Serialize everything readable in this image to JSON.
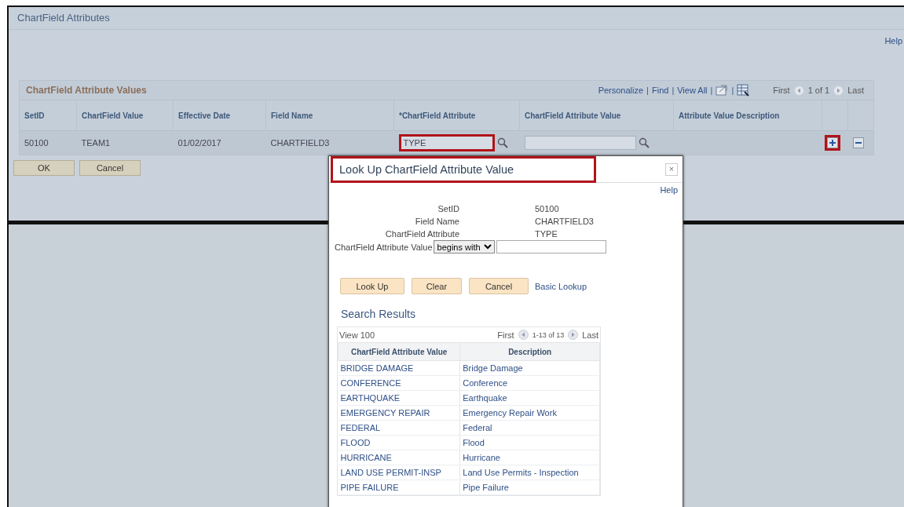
{
  "page": {
    "title": "ChartField Attributes",
    "help": "Help"
  },
  "grid": {
    "title": "ChartField Attribute Values",
    "toolbar": {
      "links": [
        "Personalize",
        "Find",
        "View All"
      ],
      "separator": "|",
      "first": "First",
      "range": "1 of 1",
      "last": "Last"
    },
    "columns": [
      "SetID",
      "ChartField Value",
      "Effective Date",
      "Field Name",
      "*ChartField Attribute",
      "ChartField Attribute Value",
      "Attribute Value Description"
    ],
    "rows": [
      {
        "setid": "50100",
        "chartfield_value": "TEAM1",
        "effective_date": "01/02/2017",
        "field_name": "CHARTFIELD3",
        "attribute": "TYPE",
        "attribute_highlighted": true,
        "add_highlighted": true
      }
    ]
  },
  "buttons": [
    "OK",
    "Cancel"
  ],
  "lookup": {
    "title": "Look Up ChartField Attribute Value",
    "title_highlighted": true,
    "close": "×",
    "help": "Help",
    "criteria": [
      {
        "label": "SetID",
        "value": "50100"
      },
      {
        "label": "Field Name",
        "value": "CHARTFIELD3"
      },
      {
        "label": "ChartField Attribute",
        "value": "TYPE"
      }
    ],
    "search_field": {
      "label": "ChartField Attribute Value",
      "operator": "begins with"
    },
    "buttons": [
      "Look Up",
      "Clear",
      "Cancel"
    ],
    "basic_lookup": "Basic Lookup",
    "results": {
      "title": "Search Results",
      "view": "View 100",
      "first": "First",
      "range": "1-13 of 13",
      "last": "Last",
      "columns": [
        "ChartField Attribute Value",
        "Description"
      ],
      "rows": [
        [
          "BRIDGE DAMAGE",
          "Bridge Damage"
        ],
        [
          "CONFERENCE",
          "Conference"
        ],
        [
          "EARTHQUAKE",
          "Earthquake"
        ],
        [
          "EMERGENCY REPAIR",
          "Emergency Repair Work"
        ],
        [
          "FEDERAL",
          "Federal"
        ],
        [
          "FLOOD",
          "Flood"
        ],
        [
          "HURRICANE",
          "Hurricane"
        ],
        [
          "LAND USE PERMIT-INSP",
          "Land Use Permits - Inspection"
        ],
        [
          "PIPE FAILURE",
          "Pipe Failure"
        ]
      ]
    }
  }
}
